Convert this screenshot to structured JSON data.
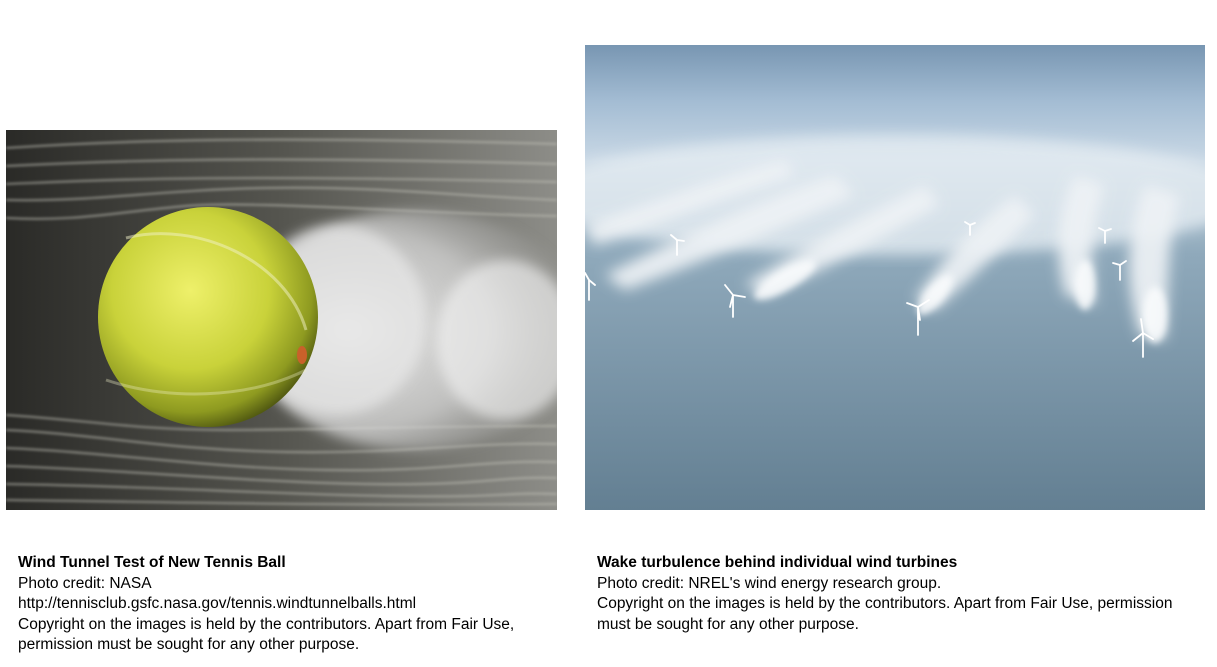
{
  "left_panel": {
    "title": "Wind Tunnel Test of New Tennis Ball",
    "credit": "Photo credit: NASA",
    "url": "http://tennisclub.gsfc.nasa.gov/tennis.windtunnelballs.html",
    "copyright": "Copyright on the images is held by the contributors. Apart from Fair Use, permission must be sought for any other purpose."
  },
  "right_panel": {
    "title": "Wake turbulence behind individual wind turbines",
    "credit": "Photo credit: NREL's wind energy research group.",
    "copyright": "Copyright on the images is held by the contributors. Apart from Fair Use, permission must be sought for any other purpose."
  },
  "colors": {
    "ball": "#d9e04a",
    "smoke": "#e6e6e6",
    "sea": "#6f8ea2",
    "sky": "#a9c3da"
  }
}
